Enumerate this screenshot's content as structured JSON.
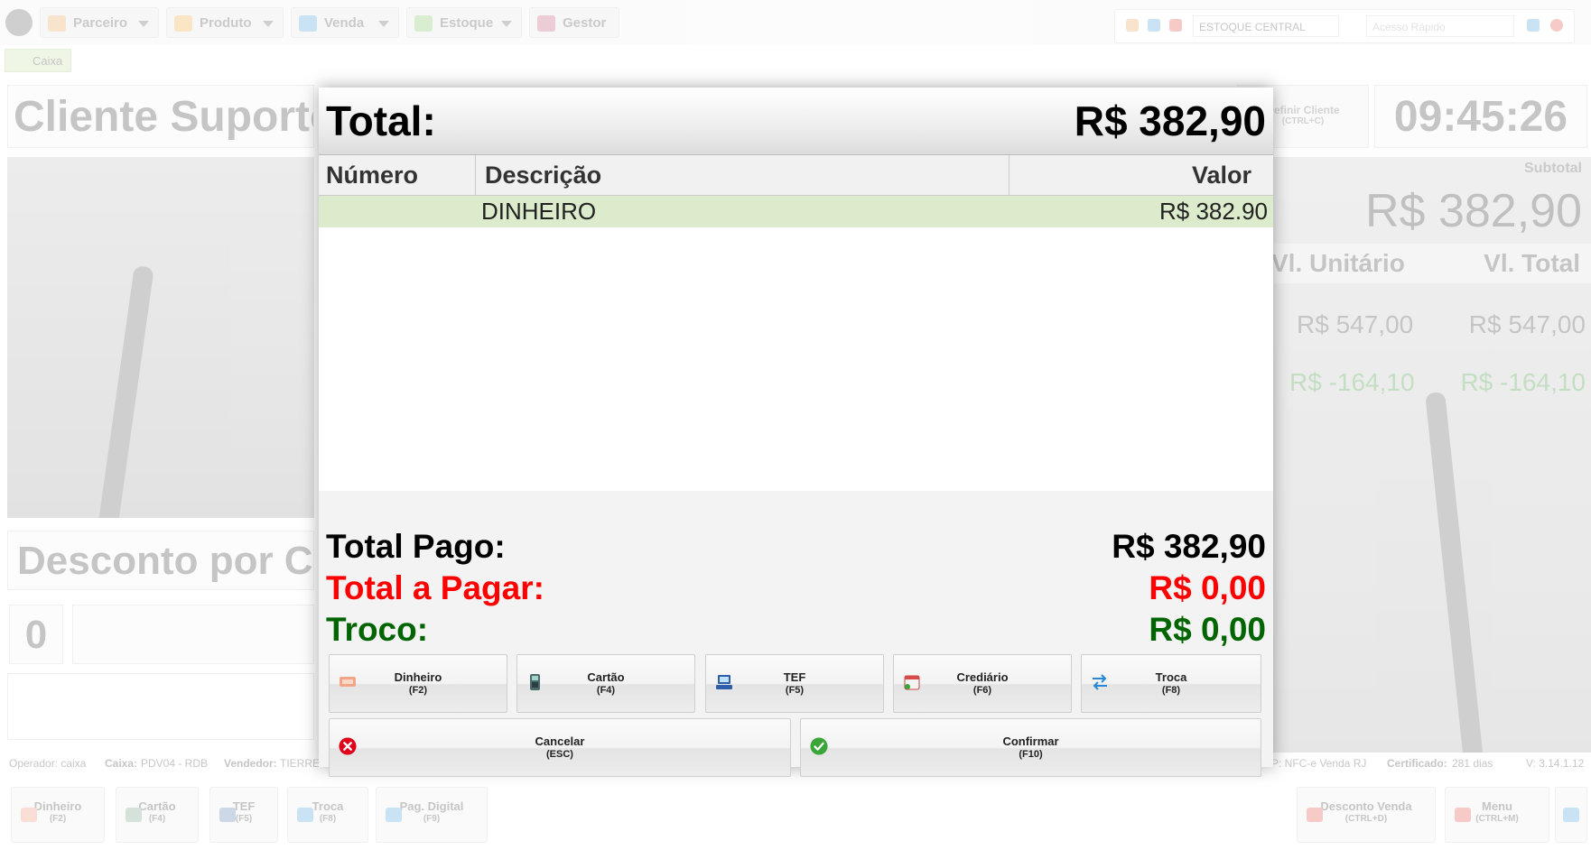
{
  "topbar": {
    "menus": [
      {
        "label": "Parceiro",
        "icon": "users-icon"
      },
      {
        "label": "Produto",
        "icon": "box-icon"
      },
      {
        "label": "Venda",
        "icon": "cart-icon"
      },
      {
        "label": "Estoque",
        "icon": "stock-icon"
      },
      {
        "label": "Gestor",
        "icon": "chart-icon"
      }
    ],
    "stock_select": "ESTOQUE CENTRAL",
    "quick_access_placeholder": "Acesso Rápido",
    "active_tab": "Caixa"
  },
  "background": {
    "client_name": "Cliente Suporte",
    "define_client": "Definir Cliente",
    "define_client_key": "(CTRL+C)",
    "clock": "09:45:26",
    "subtotal_label": "Subtotal",
    "subtotal_value": "R$ 382,90",
    "columns": [
      "Vl. Unitário",
      "Vl. Total"
    ],
    "rows": [
      {
        "unit": "R$ 547,00",
        "total": "R$ 547,00"
      },
      {
        "unit": "R$ -164,10",
        "total": "R$ -164,10"
      }
    ],
    "discount_label": "Desconto por C",
    "quantity": "0"
  },
  "statusbar": {
    "operator": "Operador: caixa",
    "caixa_label": "Caixa:",
    "caixa_value": "PDV04 - RDB",
    "vendedor_label": "Vendedor:",
    "vendedor_value": "TIERRE",
    "top": "P: NFC-e Venda RJ",
    "certificado_label": "Certificado:",
    "certificado_value": "281 dias",
    "version": "V: 3.14.1.12"
  },
  "bottombar": {
    "buttons": [
      {
        "label": "Dinheiro",
        "key": "(F2)"
      },
      {
        "label": "Cartão",
        "key": "(F4)"
      },
      {
        "label": "TEF",
        "key": "(F5)"
      },
      {
        "label": "Troca",
        "key": "(F8)"
      },
      {
        "label": "Pag. Digital",
        "key": "(F9)"
      }
    ],
    "discount": {
      "label": "Desconto Venda",
      "key": "(CTRL+D)"
    },
    "menu": {
      "label": "Menu",
      "key": "(CTRL+M)"
    }
  },
  "modal": {
    "title": "Total:",
    "total": "R$ 382,90",
    "table": {
      "headers": [
        "Número",
        "Descrição",
        "Valor"
      ],
      "rows": [
        {
          "numero": "",
          "descricao": "DINHEIRO",
          "valor": "R$ 382.90"
        }
      ]
    },
    "summary": {
      "paid_label": "Total Pago:",
      "paid_value": "R$ 382,90",
      "due_label": "Total a Pagar:",
      "due_value": "R$ 0,00",
      "change_label": "Troco:",
      "change_value": "R$ 0,00"
    },
    "payment_buttons": [
      {
        "label": "Dinheiro",
        "key": "(F2)",
        "icon": "cash-icon"
      },
      {
        "label": "Cartão",
        "key": "(F4)",
        "icon": "card-terminal-icon"
      },
      {
        "label": "TEF",
        "key": "(F5)",
        "icon": "tef-terminal-icon"
      },
      {
        "label": "Crediário",
        "key": "(F6)",
        "icon": "calendar-icon"
      },
      {
        "label": "Troca",
        "key": "(F8)",
        "icon": "exchange-arrows-icon"
      }
    ],
    "cancel": {
      "label": "Cancelar",
      "key": "(ESC)"
    },
    "confirm": {
      "label": "Confirmar",
      "key": "(F10)"
    }
  },
  "colors": {
    "paid": "#000000",
    "due": "#ff0000",
    "change": "#006400",
    "selected_row": "#dcebcb",
    "cancel_icon": "#e0001b",
    "confirm_icon": "#3aa63a"
  }
}
